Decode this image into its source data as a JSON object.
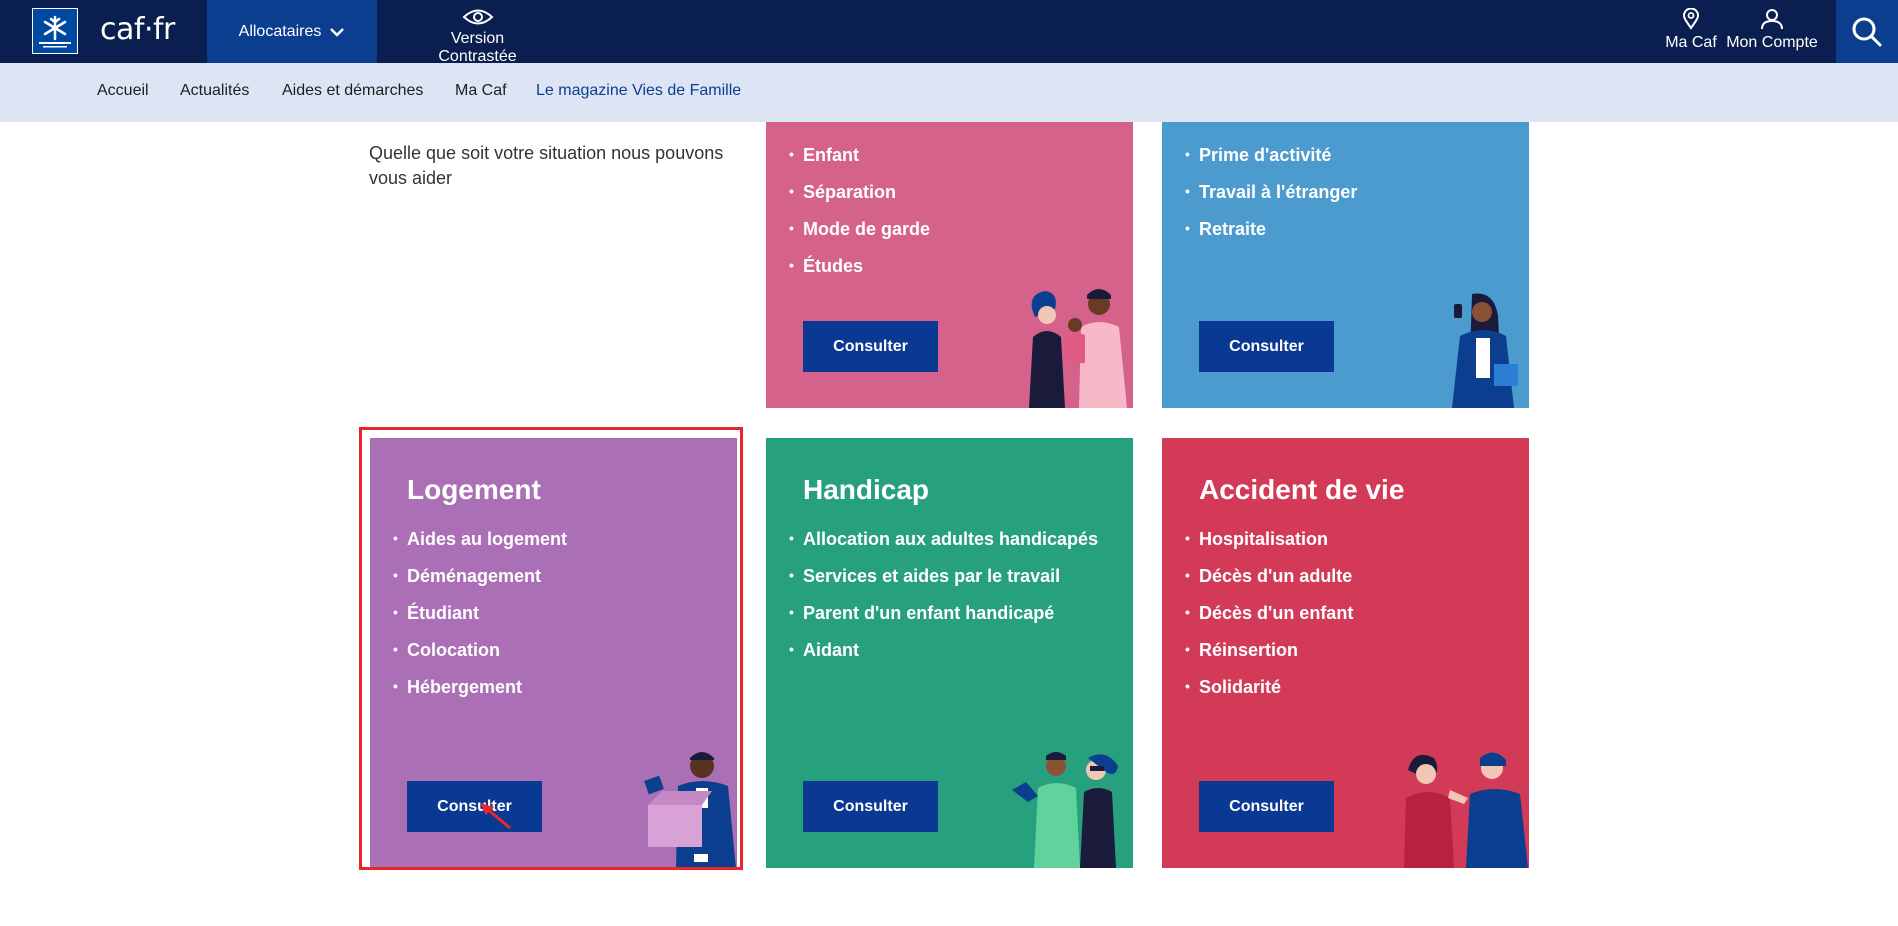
{
  "header": {
    "logo_text": "caf·fr",
    "logo_seal_text": "ALLOCATIONS FAMILIALES",
    "allocataires_label": "Allocataires",
    "contrast_label": "Version Contrastée",
    "ma_caf_label": "Ma Caf",
    "mon_compte_label": "Mon Compte",
    "icons": [
      "chevron-down-icon",
      "eye-icon",
      "location-pin-icon",
      "user-icon",
      "search-icon"
    ]
  },
  "nav": {
    "items": [
      {
        "label": "Accueil"
      },
      {
        "label": "Actualités"
      },
      {
        "label": "Aides et démarches"
      },
      {
        "label": "Ma Caf"
      },
      {
        "label": "Le magazine Vies de Famille"
      }
    ]
  },
  "intro": {
    "text": "Quelle que soit votre situation nous pouvons vous aider"
  },
  "cards": [
    {
      "title": "",
      "color": "#d5628a",
      "items": [
        "Enfant",
        "Séparation",
        "Mode de garde",
        "Études"
      ],
      "button": "Consulter"
    },
    {
      "title": "",
      "color": "#4b9bcf",
      "items": [
        "Prime d'activité",
        "Travail à l'étranger",
        "Retraite"
      ],
      "button": "Consulter"
    },
    {
      "title": "Logement",
      "color": "#ab6fb6",
      "items": [
        "Aides au logement",
        "Déménagement",
        "Étudiant",
        "Colocation",
        "Hébergement"
      ],
      "button": "Consulter"
    },
    {
      "title": "Handicap",
      "color": "#27a07d",
      "items": [
        "Allocation aux adultes handicapés",
        "Services et aides par le travail",
        "Parent d'un enfant handicapé",
        "Aidant"
      ],
      "button": "Consulter"
    },
    {
      "title": "Accident de vie",
      "color": "#d33a57",
      "items": [
        "Hospitalisation",
        "Décès d'un adulte",
        "Décès d'un enfant",
        "Réinsertion",
        "Solidarité"
      ],
      "button": "Consulter"
    }
  ],
  "colors": {
    "header_bg": "#0a1f4f",
    "header_active": "#0b3e8f",
    "nav_bg": "#dde5f4",
    "button_bg": "#0a3994",
    "highlight": "#e8262b"
  }
}
